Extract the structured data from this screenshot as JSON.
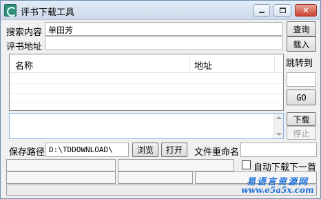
{
  "window": {
    "title": "评书下载工具",
    "controls": {
      "minimize": "—",
      "maximize": "□",
      "close": "✕"
    }
  },
  "search": {
    "label": "搜索内容",
    "value": "单田芳",
    "button": "查询"
  },
  "address": {
    "label": "评书地址",
    "value": "",
    "button": "载入"
  },
  "list": {
    "columns": [
      "名称",
      "地址"
    ],
    "rows": []
  },
  "jump": {
    "label": "跳转到",
    "value": "",
    "go_button": "GO"
  },
  "download": {
    "download_button": "下载",
    "stop_button": "停止"
  },
  "save": {
    "label": "保存路径",
    "path": "D:\\TDDOWNLOAD\\",
    "browse_button": "浏览",
    "open_button": "打开"
  },
  "rename": {
    "label": "文件重命名",
    "value": ""
  },
  "auto_next": {
    "label": "自动下载下一首",
    "checked": false
  },
  "watermark": {
    "line1": "易语言资源网",
    "line2": "www.e5a5x.com"
  },
  "icons": [
    "app-icon",
    "minimize-icon",
    "maximize-icon",
    "close-icon",
    "scroll-up-icon",
    "scroll-down-icon"
  ]
}
